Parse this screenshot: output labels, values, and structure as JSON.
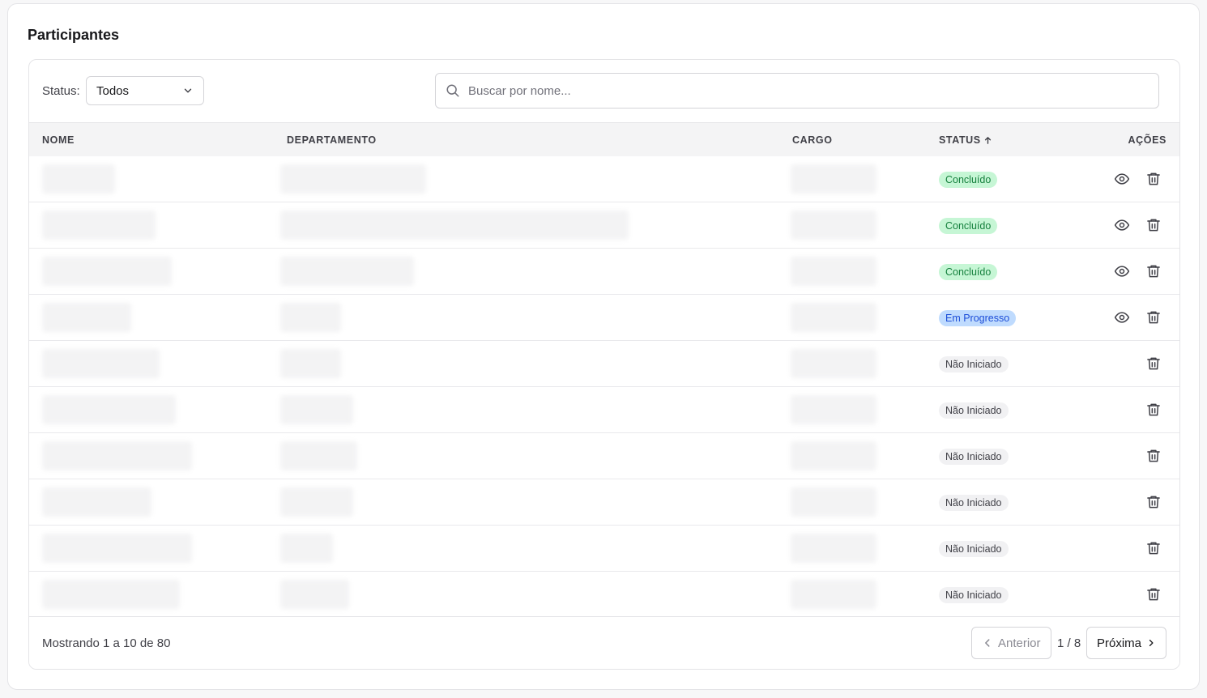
{
  "title": "Participantes",
  "filter": {
    "status_label": "Status:",
    "status_value": "Todos",
    "search_placeholder": "Buscar por nome..."
  },
  "table": {
    "headers": {
      "nome": "NOME",
      "departamento": "DEPARTAMENTO",
      "cargo": "CARGO",
      "status": "STATUS",
      "acoes": "AÇÕES"
    },
    "rows": [
      {
        "status": "Concluído",
        "kind": "done",
        "viewable": true
      },
      {
        "status": "Concluído",
        "kind": "done",
        "viewable": true
      },
      {
        "status": "Concluído",
        "kind": "done",
        "viewable": true
      },
      {
        "status": "Em Progresso",
        "kind": "progress",
        "viewable": true
      },
      {
        "status": "Não Iniciado",
        "kind": "none",
        "viewable": false
      },
      {
        "status": "Não Iniciado",
        "kind": "none",
        "viewable": false
      },
      {
        "status": "Não Iniciado",
        "kind": "none",
        "viewable": false
      },
      {
        "status": "Não Iniciado",
        "kind": "none",
        "viewable": false
      },
      {
        "status": "Não Iniciado",
        "kind": "none",
        "viewable": false
      },
      {
        "status": "Não Iniciado",
        "kind": "none",
        "viewable": false
      }
    ]
  },
  "pagination": {
    "summary": "Mostrando 1 a 10 de 80",
    "prev_label": "Anterior",
    "page_info": "1 / 8",
    "next_label": "Próxima"
  },
  "colors": {
    "done_bg": "#c6f6d5",
    "progress_bg": "#bfdbfe",
    "none_bg": "#f1f1f3"
  }
}
